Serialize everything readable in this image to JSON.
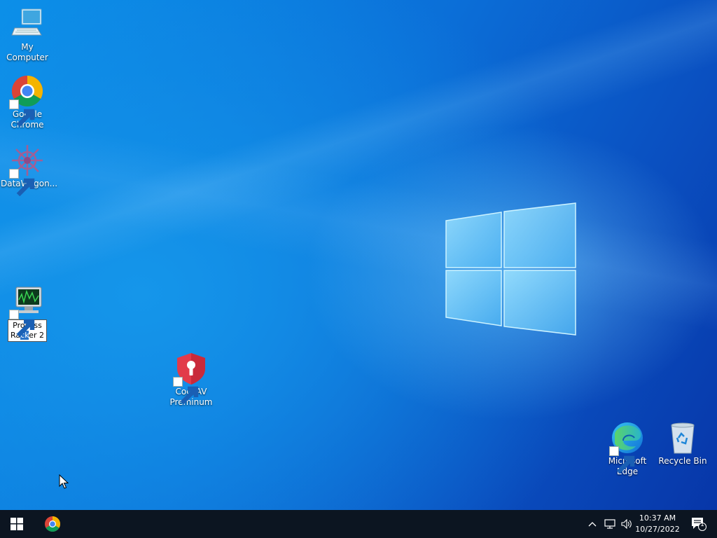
{
  "desktop": {
    "icons": [
      {
        "id": "my-computer",
        "label": "My Computer",
        "icon": "computer-icon",
        "shortcut": false
      },
      {
        "id": "google-chrome",
        "label": "Google Chrome",
        "icon": "chrome-icon",
        "shortcut": true
      },
      {
        "id": "datawagon",
        "label": "DataWagon...",
        "icon": "datawagon-icon",
        "shortcut": true
      },
      {
        "id": "process-racker",
        "label_line1": "Process",
        "label_line2_a": "Ra",
        "label_line2_sel": "ck",
        "label_line2_b": "er 2",
        "icon": "monitor-icon",
        "shortcut": true,
        "renaming": true
      },
      {
        "id": "cockav",
        "label": "CockAV Preminum",
        "icon": "shield-icon",
        "shortcut": true
      },
      {
        "id": "microsoft-edge",
        "label": "Microsoft Edge",
        "icon": "edge-icon",
        "shortcut": true
      },
      {
        "id": "recycle-bin",
        "label": "Recycle Bin",
        "icon": "recycle-bin-icon",
        "shortcut": false
      }
    ]
  },
  "taskbar": {
    "start": "windows-logo-icon",
    "pinned": [
      {
        "name": "Google Chrome",
        "icon": "chrome-icon"
      }
    ],
    "tray": {
      "time": "10:37 AM",
      "date": "10/27/2022",
      "notification_count": "1"
    }
  },
  "colors": {
    "taskbar": "#0c1521",
    "accent": "#0b6fd8"
  }
}
